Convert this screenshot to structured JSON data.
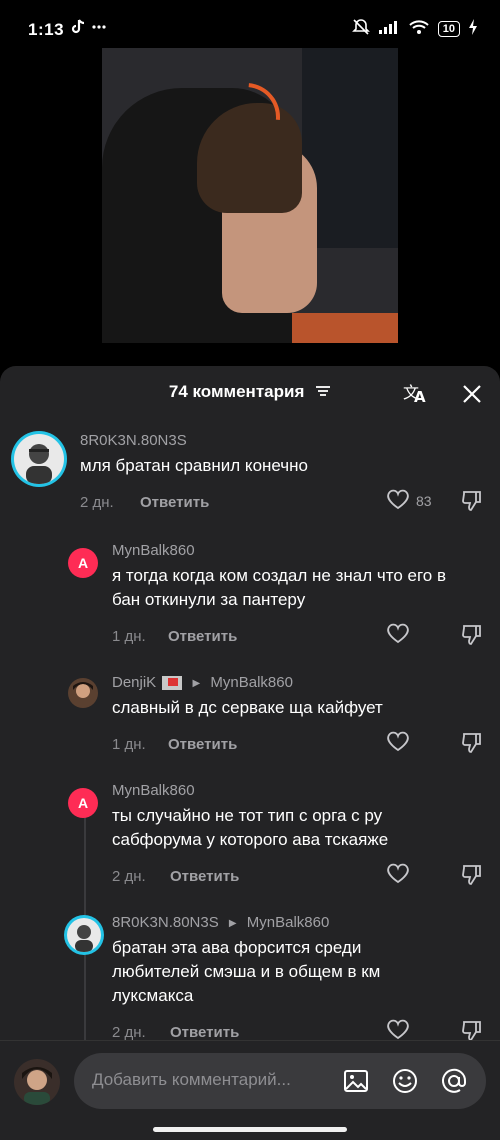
{
  "status": {
    "time": "1:13",
    "battery": "10"
  },
  "sheet": {
    "title": "74 комментария"
  },
  "comments": [
    {
      "username": "8R0K3N.80N3S",
      "text": "мля братан сравнил конечно",
      "time": "2 дн.",
      "reply": "Ответить",
      "likes": "83"
    },
    {
      "username": "MynBalk860",
      "avatar_letter": "A",
      "text": "я тогда когда ком создал не знал что его в бан откинули за пантеру",
      "time": "1 дн.",
      "reply": "Ответить"
    },
    {
      "username": "DenjiK",
      "reply_to": "MynBalk860",
      "text": "славный в дс серваке ща кайфует",
      "time": "1 дн.",
      "reply": "Ответить"
    },
    {
      "username": "MynBalk860",
      "avatar_letter": "A",
      "text": "ты случайно не тот тип с орга с ру сабфорума у которого ава тскаяже",
      "time": "2 дн.",
      "reply": "Ответить"
    },
    {
      "username": "8R0K3N.80N3S",
      "reply_to": "MynBalk860",
      "text": "братан эта ава форсится среди любителей смэша и в общем в км луксмакса",
      "time": "2 дн.",
      "reply": "Ответить"
    }
  ],
  "input": {
    "placeholder": "Добавить комментарий..."
  },
  "colors": {
    "accent_ring": "#23c3e6",
    "letter_avatar": "#fe2c55",
    "sheet_bg": "#232325"
  }
}
